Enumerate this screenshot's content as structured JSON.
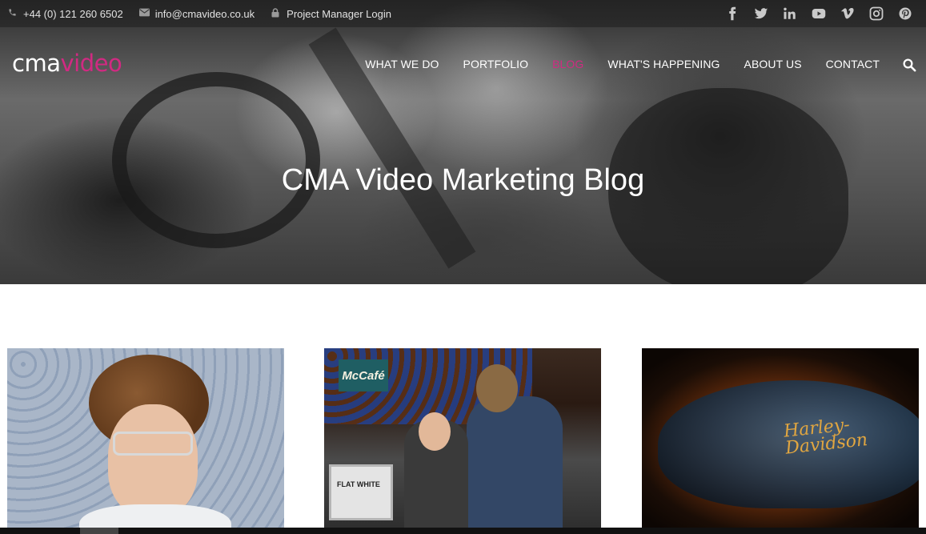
{
  "topbar": {
    "phone": "+44 (0) 121 260 6502",
    "email": "info@cmavideo.co.uk",
    "login": "Project Manager Login"
  },
  "socials": [
    "facebook-icon",
    "twitter-icon",
    "linkedin-icon",
    "youtube-icon",
    "vimeo-icon",
    "instagram-icon",
    "pinterest-icon"
  ],
  "logo": {
    "part1": "cma",
    "part2": "video"
  },
  "nav": {
    "items": [
      "WHAT WE DO",
      "PORTFOLIO",
      "BLOG",
      "WHAT'S HAPPENING",
      "ABOUT US",
      "CONTACT"
    ],
    "active": "BLOG"
  },
  "hero": {
    "title": "CMA Video Marketing Blog"
  },
  "cards": [
    {
      "image": "man-with-glasses-photo"
    },
    {
      "image": "mccafe-counter-photo",
      "sign": "McCafé",
      "till_text": "FLAT WHITE"
    },
    {
      "image": "harley-davidson-tank-photo",
      "brand": "Harley-Davidson"
    }
  ],
  "colors": {
    "accent": "#d12a82",
    "text_light": "#ffffff"
  }
}
